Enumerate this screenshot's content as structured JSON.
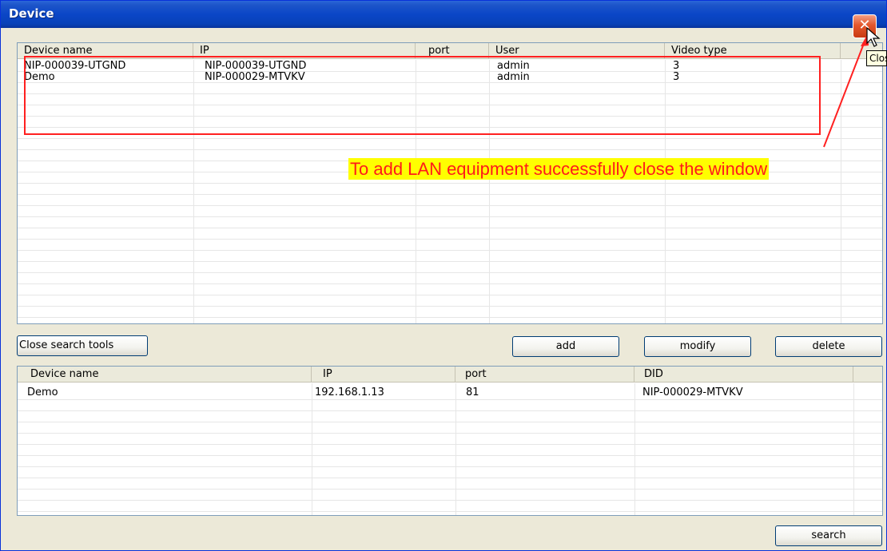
{
  "window": {
    "title": "Device",
    "close_symbol": "✕",
    "tooltip": "Close"
  },
  "top_table": {
    "columns": [
      "Device name",
      "IP",
      "port",
      "User",
      "Video type"
    ],
    "rows": [
      [
        "NIP-000039-UTGND",
        "NIP-000039-UTGND",
        "",
        "admin",
        "3"
      ],
      [
        "Demo",
        "NIP-000029-MTVKV",
        "",
        "admin",
        "3"
      ]
    ]
  },
  "buttons": {
    "close_search_tools": "Close search tools",
    "add": "add",
    "modify": "modify",
    "delete": "delete",
    "search": "search"
  },
  "bottom_table": {
    "columns": [
      "Device name",
      "IP",
      "port",
      "DID"
    ],
    "rows": [
      [
        "Demo",
        "192.168.1.13",
        "81",
        "NIP-000029-MTVKV"
      ]
    ]
  },
  "annotation": {
    "text": "To add LAN equipment successfully close the window",
    "text_color": "#ff1a1a",
    "background": "#ffff00"
  },
  "colors": {
    "titlebar": "#0a46c7",
    "close_button": "#e3562b",
    "highlight": "#ff2020"
  }
}
